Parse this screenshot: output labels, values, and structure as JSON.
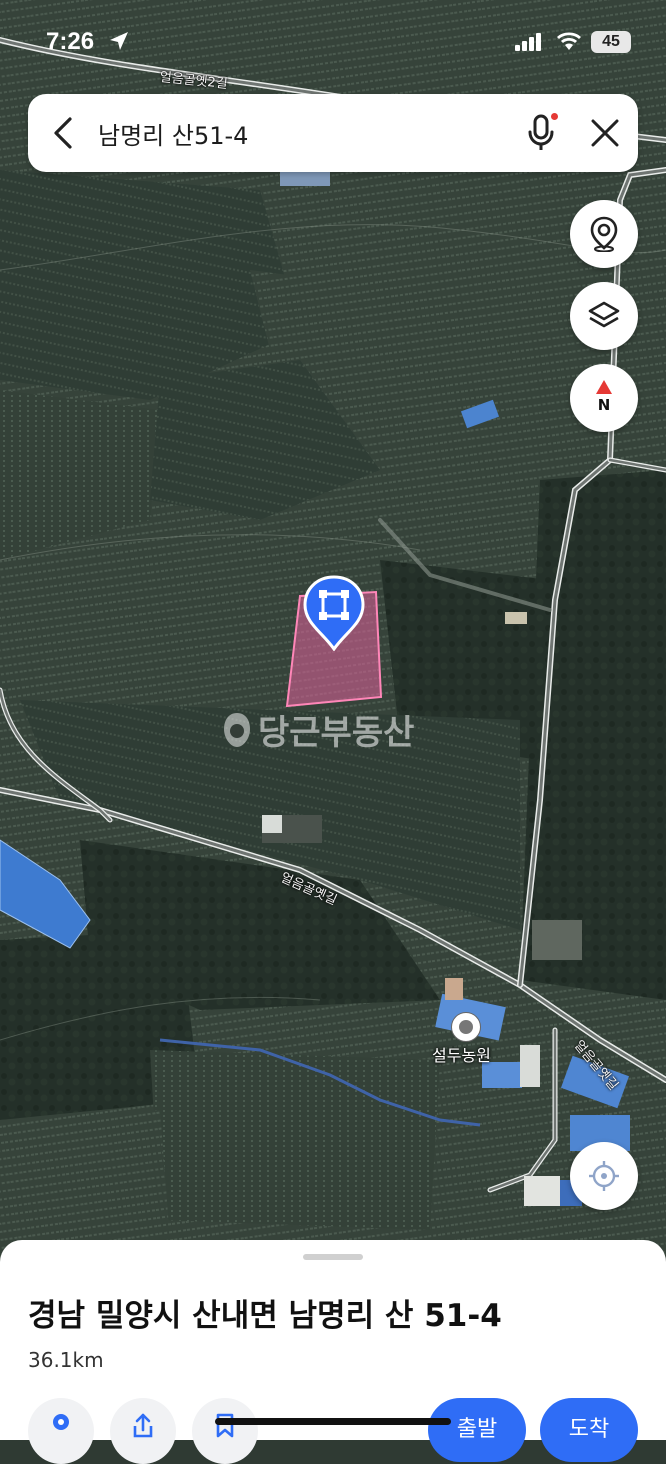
{
  "status_bar": {
    "time": "7:26",
    "battery": "45"
  },
  "search": {
    "query": "남명리 산51-4"
  },
  "map": {
    "road_labels": [
      "얼음골옛2길",
      "얼음골옛길",
      "얼음골옛길"
    ],
    "poi_label": "설두농원",
    "watermark": "당근부동산",
    "compass_label": "N",
    "parcel_color": "#e0609a",
    "pin_color": "#2f6df6"
  },
  "place": {
    "address": "경남 밀양시 산내면 남명리 산 51-4",
    "distance": "36.1km"
  },
  "actions": {
    "depart_label": "출발",
    "arrive_label": "도착"
  },
  "colors": {
    "accent": "#2f6df6",
    "compass_red": "#e53935"
  },
  "icons": [
    "back-arrow-icon",
    "microphone-icon",
    "close-icon",
    "street-view-icon",
    "layers-icon",
    "compass-icon",
    "current-location-icon",
    "parcel-pin-icon",
    "place-icon",
    "share-icon",
    "save-icon"
  ]
}
